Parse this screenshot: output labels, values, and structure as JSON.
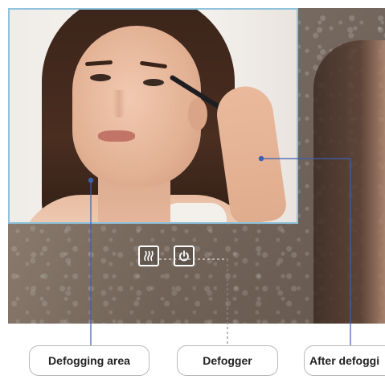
{
  "labels": {
    "defogging_area": "Defogging area",
    "defogger": "Defogger",
    "after_defogging": "After defoggi"
  },
  "icons": {
    "defog_control": "defog-heater-icon",
    "power_control": "power-icon"
  },
  "colors": {
    "clear_area_border": "#8fc3dc",
    "callout_line": "#3d5fae",
    "label_border": "#b9b9b9",
    "label_text": "#222222"
  }
}
